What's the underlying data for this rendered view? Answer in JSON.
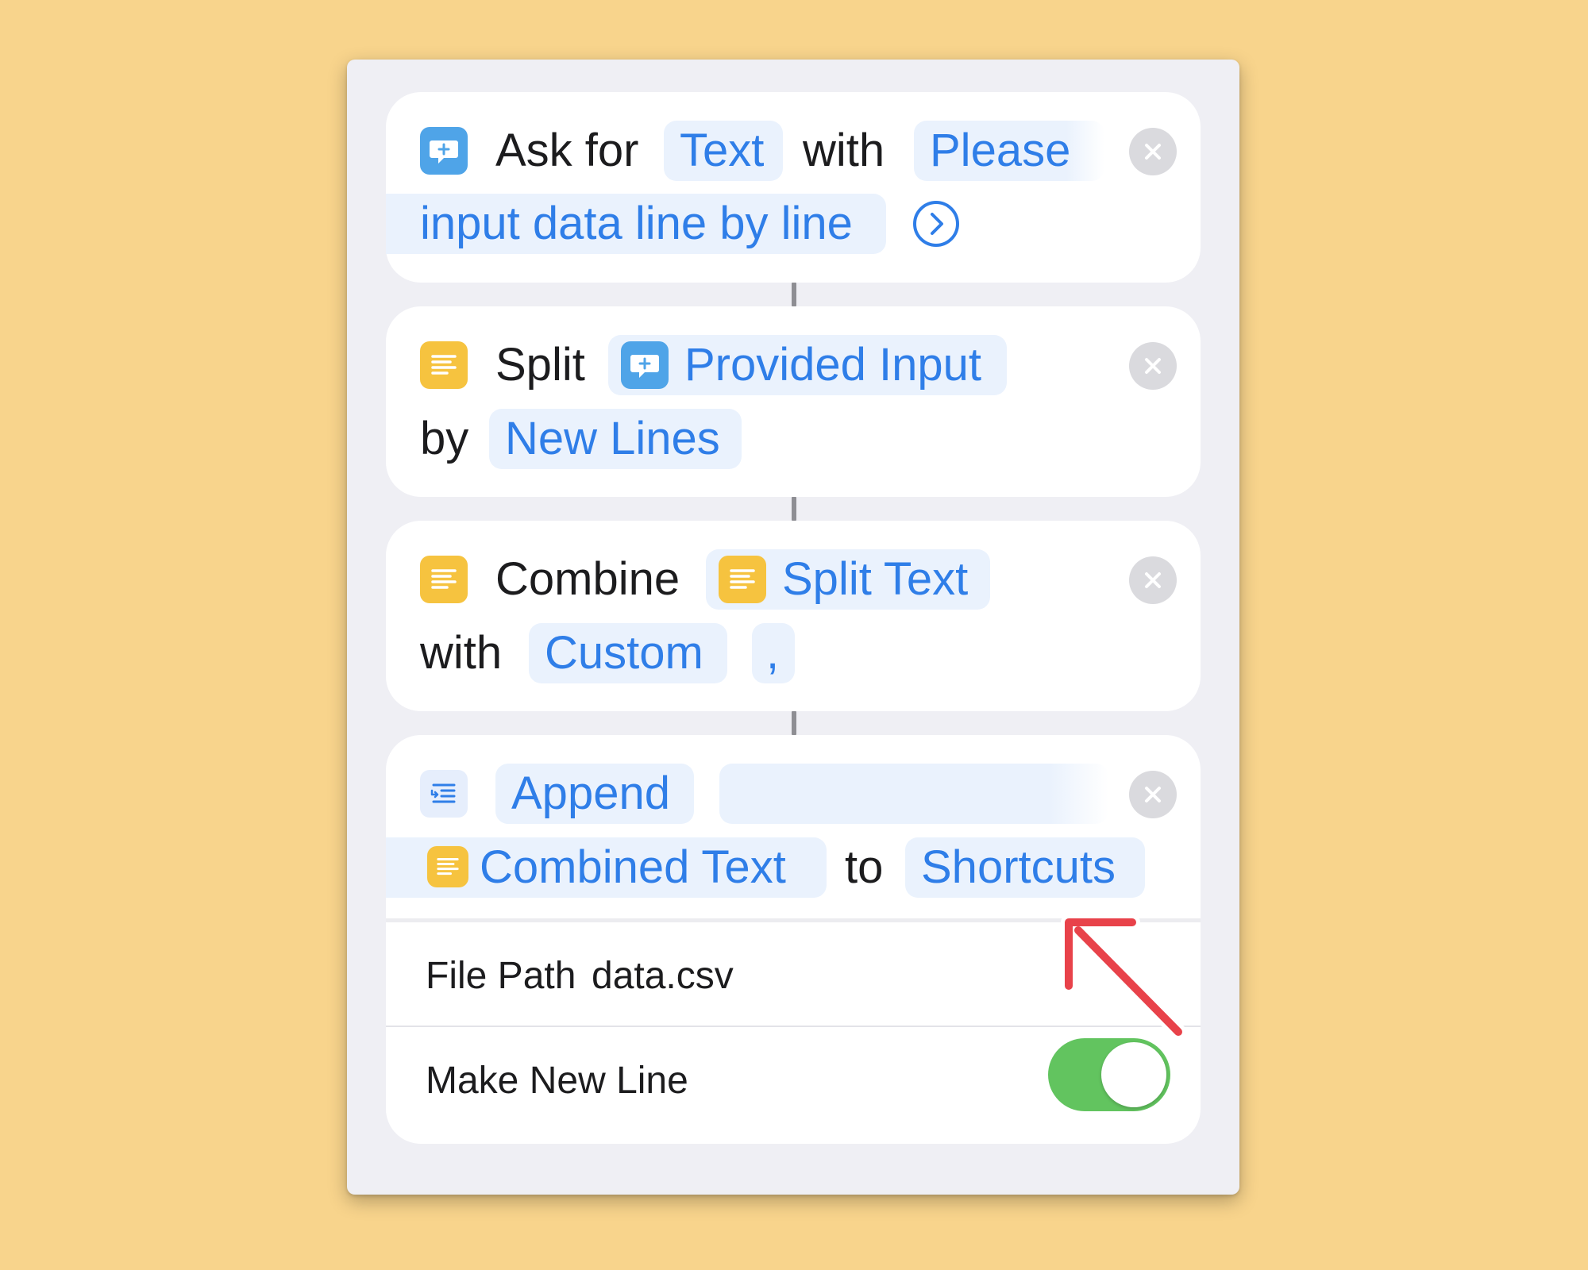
{
  "actions": {
    "ask": {
      "prefix": "Ask for",
      "type_token": "Text",
      "with_label": "with",
      "prompt_line1": "Please",
      "prompt_line2": "input data line by line"
    },
    "split": {
      "prefix": "Split",
      "input_token": "Provided Input",
      "by_label": "by",
      "separator_token": "New Lines"
    },
    "combine": {
      "prefix": "Combine",
      "input_token": "Split Text",
      "with_label": "with",
      "mode_token": "Custom",
      "custom_token": ","
    },
    "append": {
      "action_token": "Append",
      "input_token": "Combined Text",
      "to_label": "to",
      "destination_token": "Shortcuts",
      "file_path_label": "File Path",
      "file_path_value": "data.csv",
      "make_new_line_label": "Make New Line",
      "make_new_line_enabled": true
    }
  },
  "colors": {
    "background": "#f8d48c",
    "token_text": "#2f7ee8",
    "token_bg": "#eaf2fd",
    "toggle_on": "#62c45f",
    "annotation_arrow": "#e8424a"
  },
  "icons": {
    "ask": "speech-bubble-plus-icon",
    "text": "text-lines-icon",
    "append": "append-text-icon",
    "remove": "close-icon",
    "expand": "chevron-right-circle-icon"
  }
}
